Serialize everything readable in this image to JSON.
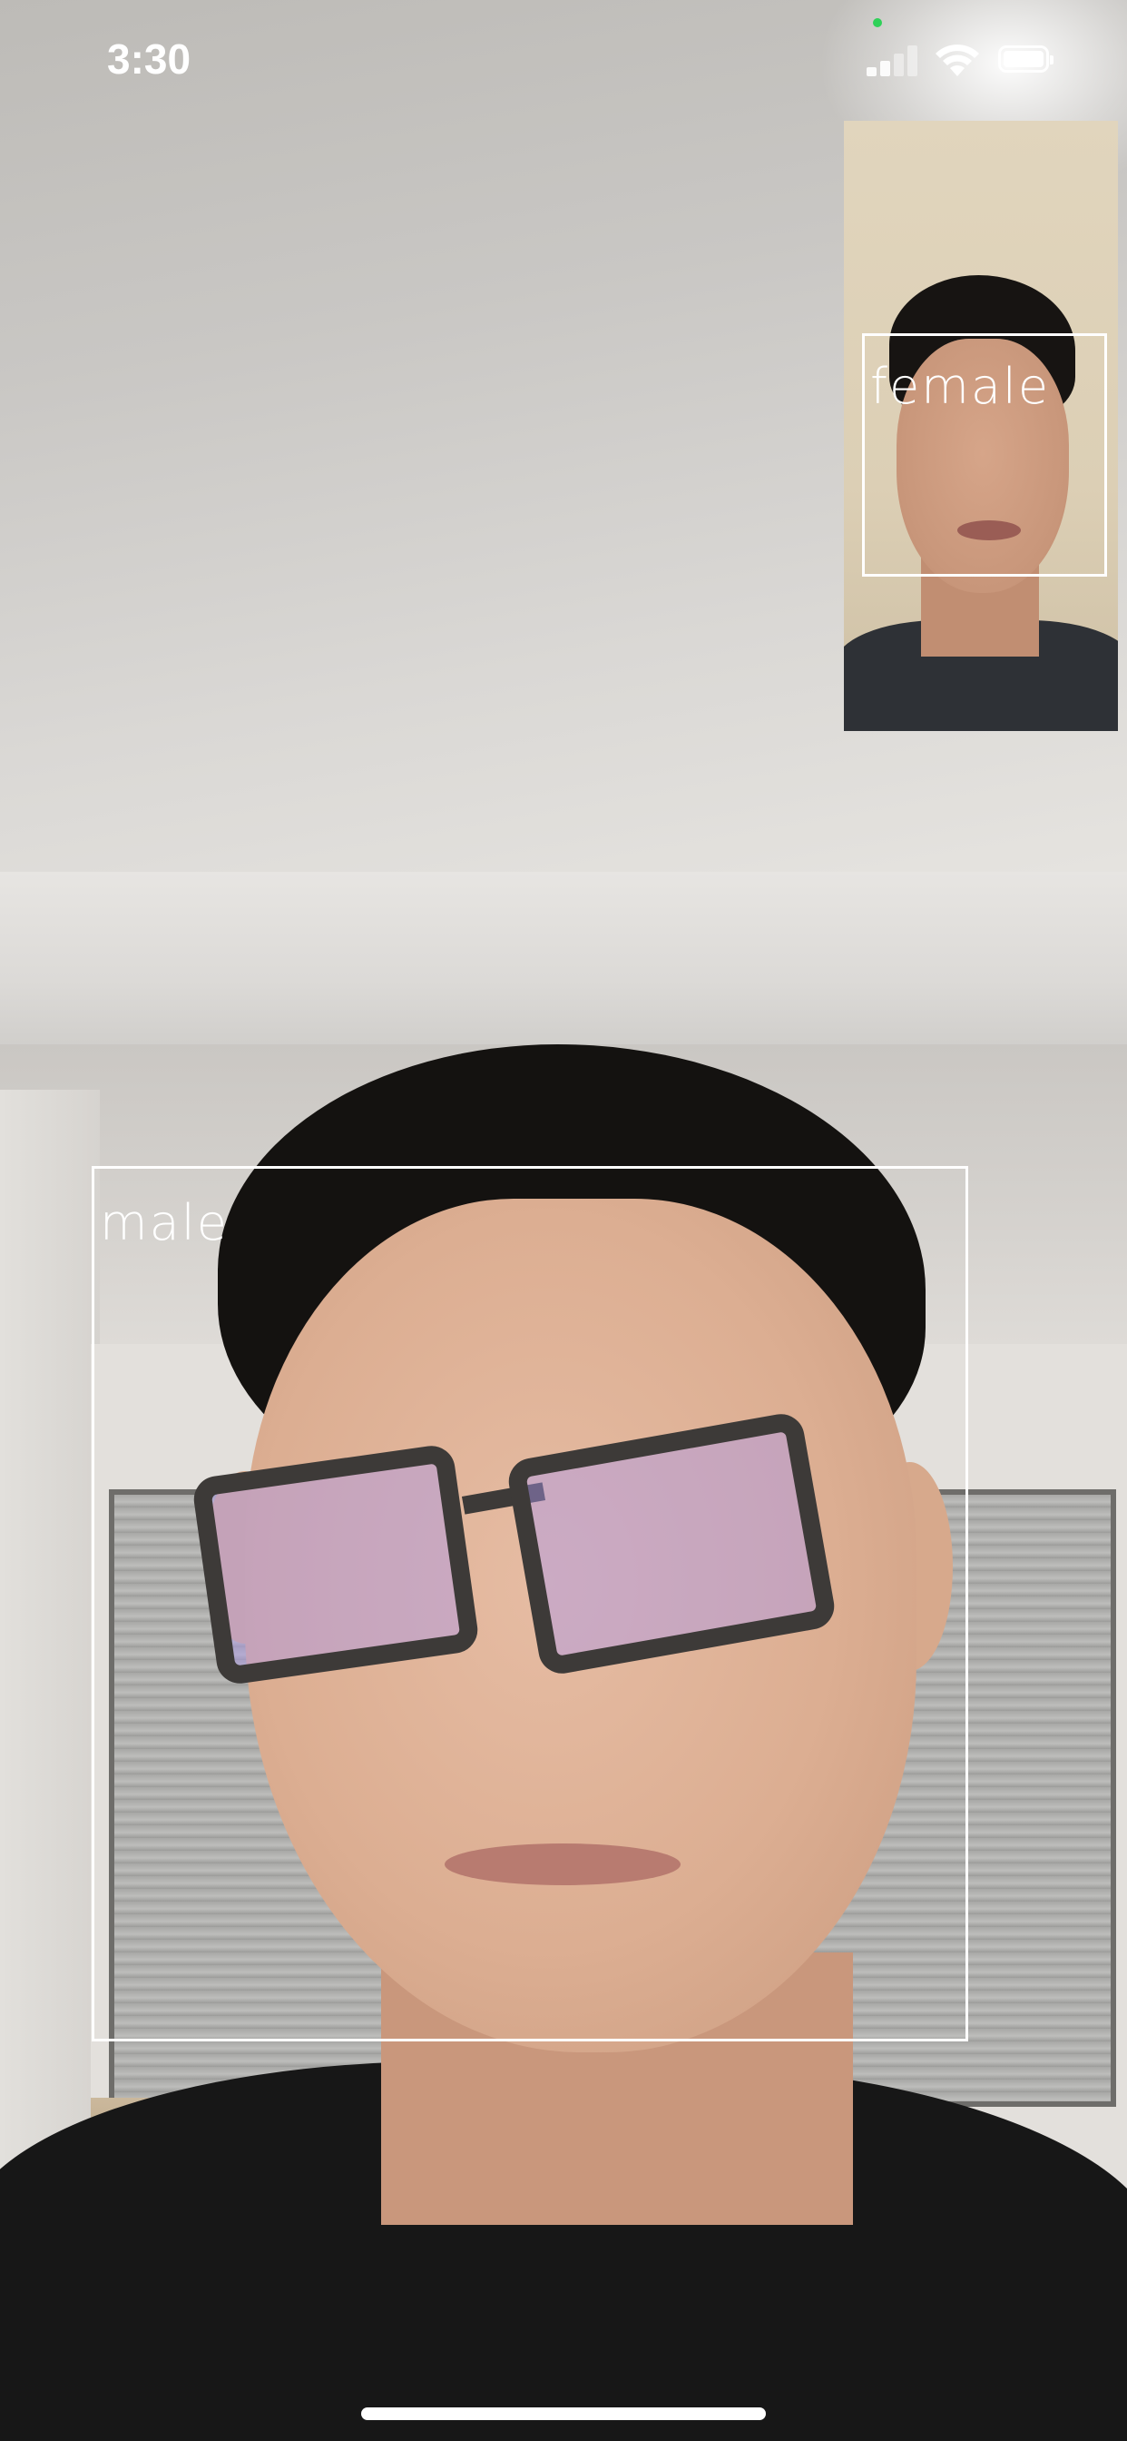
{
  "status_bar": {
    "time": "3:30",
    "icons": [
      "signal-icon",
      "wifi-icon",
      "battery-icon"
    ],
    "recording_indicator_color": "#2fd158"
  },
  "main_camera": {
    "detection_label": "male",
    "box_color": "#ffffff"
  },
  "pip_camera": {
    "detection_label": "female",
    "box_color": "#ffffff"
  }
}
